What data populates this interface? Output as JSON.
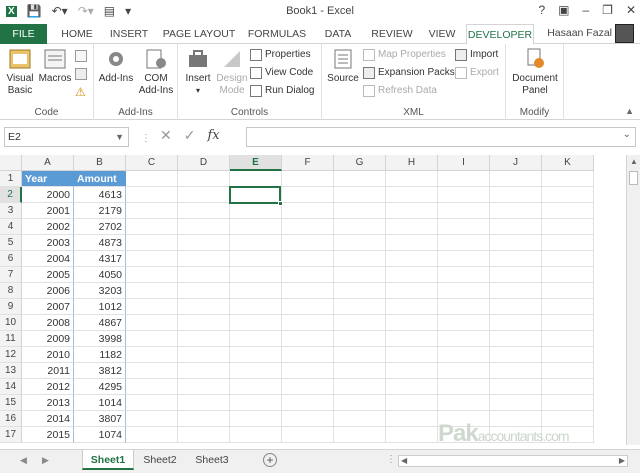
{
  "window": {
    "title": "Book1 - Excel",
    "user": "Hasaan Fazal"
  },
  "qat": [
    "save-icon",
    "undo-icon",
    "redo-icon",
    "form-icon",
    "customize-icon"
  ],
  "tabs": [
    "FILE",
    "HOME",
    "INSERT",
    "PAGE LAYOUT",
    "FORMULAS",
    "DATA",
    "REVIEW",
    "VIEW",
    "DEVELOPER"
  ],
  "active_tab": "DEVELOPER",
  "ribbon": {
    "code": {
      "label": "Code",
      "visual_basic_1": "Visual",
      "visual_basic_2": "Basic",
      "macros": "Macros"
    },
    "addins": {
      "label": "Add-Ins",
      "addins": "Add-Ins",
      "com_1": "COM",
      "com_2": "Add-Ins"
    },
    "controls": {
      "label": "Controls",
      "insert": "Insert",
      "design_1": "Design",
      "design_2": "Mode",
      "properties": "Properties",
      "view_code": "View Code",
      "run_dialog": "Run Dialog"
    },
    "xml": {
      "label": "XML",
      "source": "Source",
      "map_properties": "Map Properties",
      "expansion_packs": "Expansion Packs",
      "refresh_data": "Refresh Data",
      "import": "Import",
      "export": "Export"
    },
    "modify": {
      "label": "Modify",
      "doc_panel_1": "Document",
      "doc_panel_2": "Panel"
    }
  },
  "formula_bar": {
    "name_box": "E2",
    "fx": "fx",
    "value": ""
  },
  "columns": [
    "A",
    "B",
    "C",
    "D",
    "E",
    "F",
    "G",
    "H",
    "I",
    "J",
    "K"
  ],
  "selected_column": "E",
  "selected_row": "2",
  "rows": [
    "1",
    "2",
    "3",
    "4",
    "5",
    "6",
    "7",
    "8",
    "9",
    "10",
    "11",
    "12",
    "13",
    "14",
    "15",
    "16",
    "17"
  ],
  "table": {
    "headers": [
      "Year",
      "Amount"
    ],
    "data": [
      [
        "2000",
        "4613"
      ],
      [
        "2001",
        "2179"
      ],
      [
        "2002",
        "2702"
      ],
      [
        "2003",
        "4873"
      ],
      [
        "2004",
        "4317"
      ],
      [
        "2005",
        "4050"
      ],
      [
        "2006",
        "3203"
      ],
      [
        "2007",
        "1012"
      ],
      [
        "2008",
        "4867"
      ],
      [
        "2009",
        "3998"
      ],
      [
        "2010",
        "1182"
      ],
      [
        "2011",
        "3812"
      ],
      [
        "2012",
        "4295"
      ],
      [
        "2013",
        "1014"
      ],
      [
        "2014",
        "3807"
      ],
      [
        "2015",
        "1074"
      ]
    ]
  },
  "sheets": [
    "Sheet1",
    "Sheet2",
    "Sheet3"
  ],
  "active_sheet": "Sheet1",
  "watermark": {
    "big": "Pak",
    "small": "accountants.com"
  },
  "colors": {
    "accent": "#217346",
    "table_header": "#5b9bd5"
  }
}
